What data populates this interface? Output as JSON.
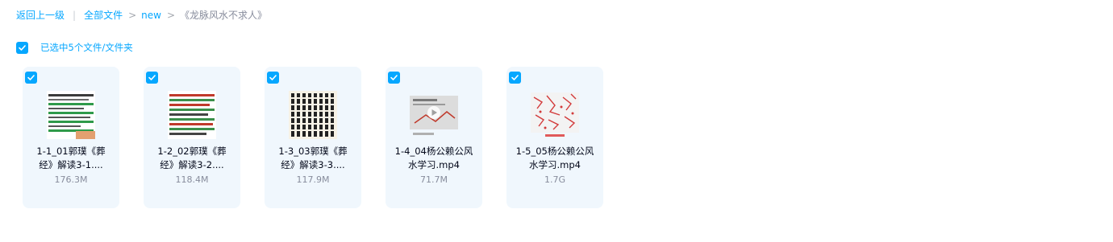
{
  "breadcrumb": {
    "back": "返回上一级",
    "root": "全部文件",
    "sep1": ">",
    "folder": "new",
    "sep2": ">",
    "current": "《龙脉风水不求人》"
  },
  "selection": {
    "status": "已选中5个文件/文件夹",
    "checked": true
  },
  "files": [
    {
      "name_line1": "1-1_01郭璞《葬",
      "name_line2": "经》解读3-1....",
      "size": "176.3M",
      "thumb": "document-thumbnail-green",
      "checked": true
    },
    {
      "name_line1": "1-2_02郭璞《葬",
      "name_line2": "经》解读3-2....",
      "size": "118.4M",
      "thumb": "document-thumbnail-green-red",
      "checked": true
    },
    {
      "name_line1": "1-3_03郭璞《葬",
      "name_line2": "经》解读3-3....",
      "size": "117.9M",
      "thumb": "document-thumbnail-dark-text",
      "checked": true
    },
    {
      "name_line1": "1-4_04杨公赖公风",
      "name_line2": "水学习.mp4",
      "size": "71.7M",
      "thumb": "video-thumbnail-play",
      "checked": true
    },
    {
      "name_line1": "1-5_05杨公赖公风",
      "name_line2": "水学习.mp4",
      "size": "1.7G",
      "thumb": "video-thumbnail-red-marks",
      "checked": true
    }
  ],
  "colors": {
    "accent": "#06a7ff",
    "card_bg": "#f0f7fd",
    "text": "#03081a",
    "muted": "#878c9c"
  }
}
